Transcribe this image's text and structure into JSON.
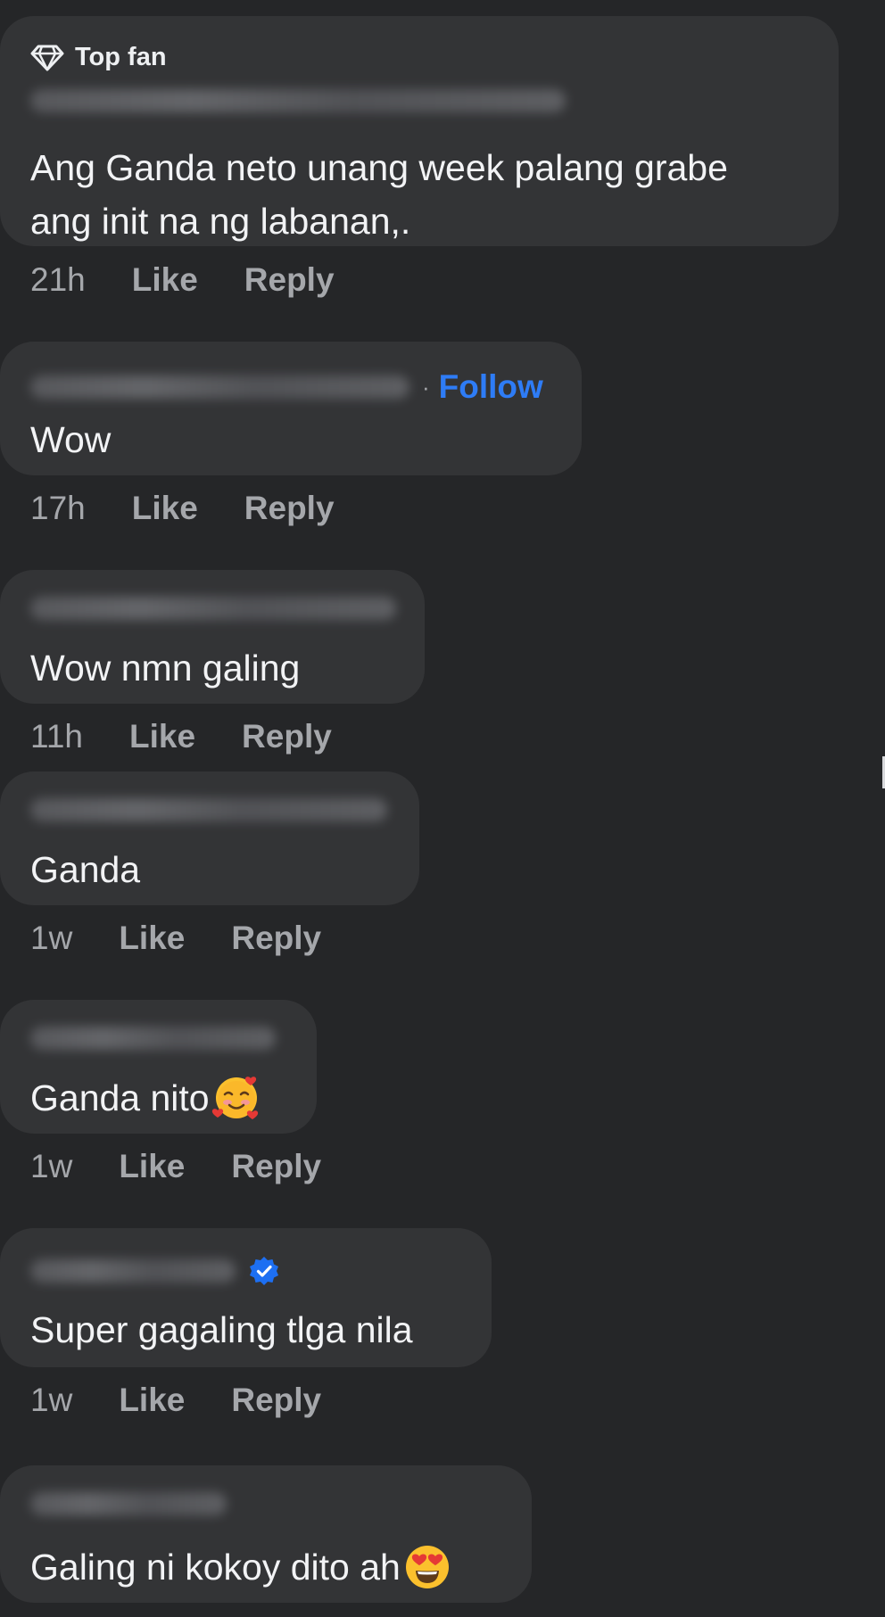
{
  "comments": [
    {
      "badge": "Top fan",
      "text_lines": [
        "Ang Ganda neto unang week palang grabe",
        "ang init na ng labanan,."
      ],
      "time": "21h",
      "like": "Like",
      "reply": "Reply"
    },
    {
      "follow": "Follow",
      "follow_sep": "·",
      "text_lines": [
        "Wow"
      ],
      "time": "17h",
      "like": "Like",
      "reply": "Reply"
    },
    {
      "text_lines": [
        "Wow nmn galing"
      ],
      "time": "11h",
      "like": "Like",
      "reply": "Reply"
    },
    {
      "text_lines": [
        "Ganda"
      ],
      "time": "1w",
      "like": "Like",
      "reply": "Reply"
    },
    {
      "text_lines": [
        "Ganda nito"
      ],
      "emoji": "smiling-face-with-hearts",
      "time": "1w",
      "like": "Like",
      "reply": "Reply"
    },
    {
      "verified": true,
      "text_lines": [
        "Super gagaling tlga nila"
      ],
      "time": "1w",
      "like": "Like",
      "reply": "Reply"
    },
    {
      "text_lines": [
        "Galing ni kokoy dito ah"
      ],
      "emoji": "smiling-face-with-heart-eyes"
    }
  ],
  "colors": {
    "background": "#252628",
    "bubble": "#333436",
    "text": "#f2f3f5",
    "muted": "#a5a7ab",
    "follow": "#2e7cf6",
    "verified": "#1d6ff2"
  }
}
